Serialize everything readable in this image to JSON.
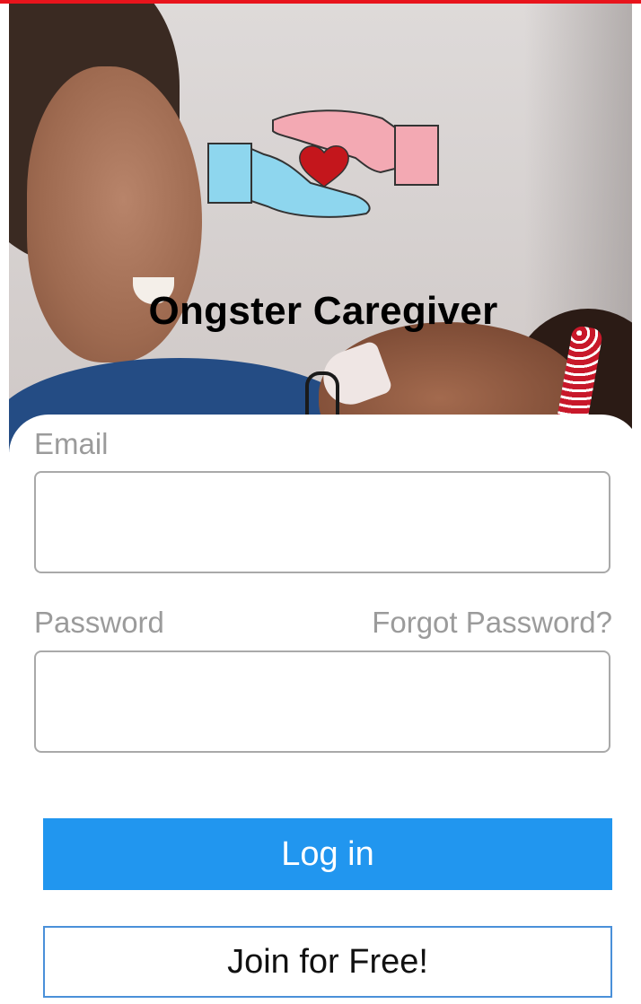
{
  "app": {
    "title": "Ongster Caregiver",
    "logo_icon": "hands-heart-icon",
    "accent_color": "#2196ef",
    "top_bar_color": "#e8141c"
  },
  "hero": {
    "image": "mother-and-baby-photo"
  },
  "form": {
    "email_label": "Email",
    "email_value": "",
    "email_placeholder": "",
    "password_label": "Password",
    "password_value": "",
    "password_placeholder": "",
    "forgot_password_label": "Forgot Password?",
    "login_label": "Log in",
    "join_label": "Join for Free!"
  }
}
